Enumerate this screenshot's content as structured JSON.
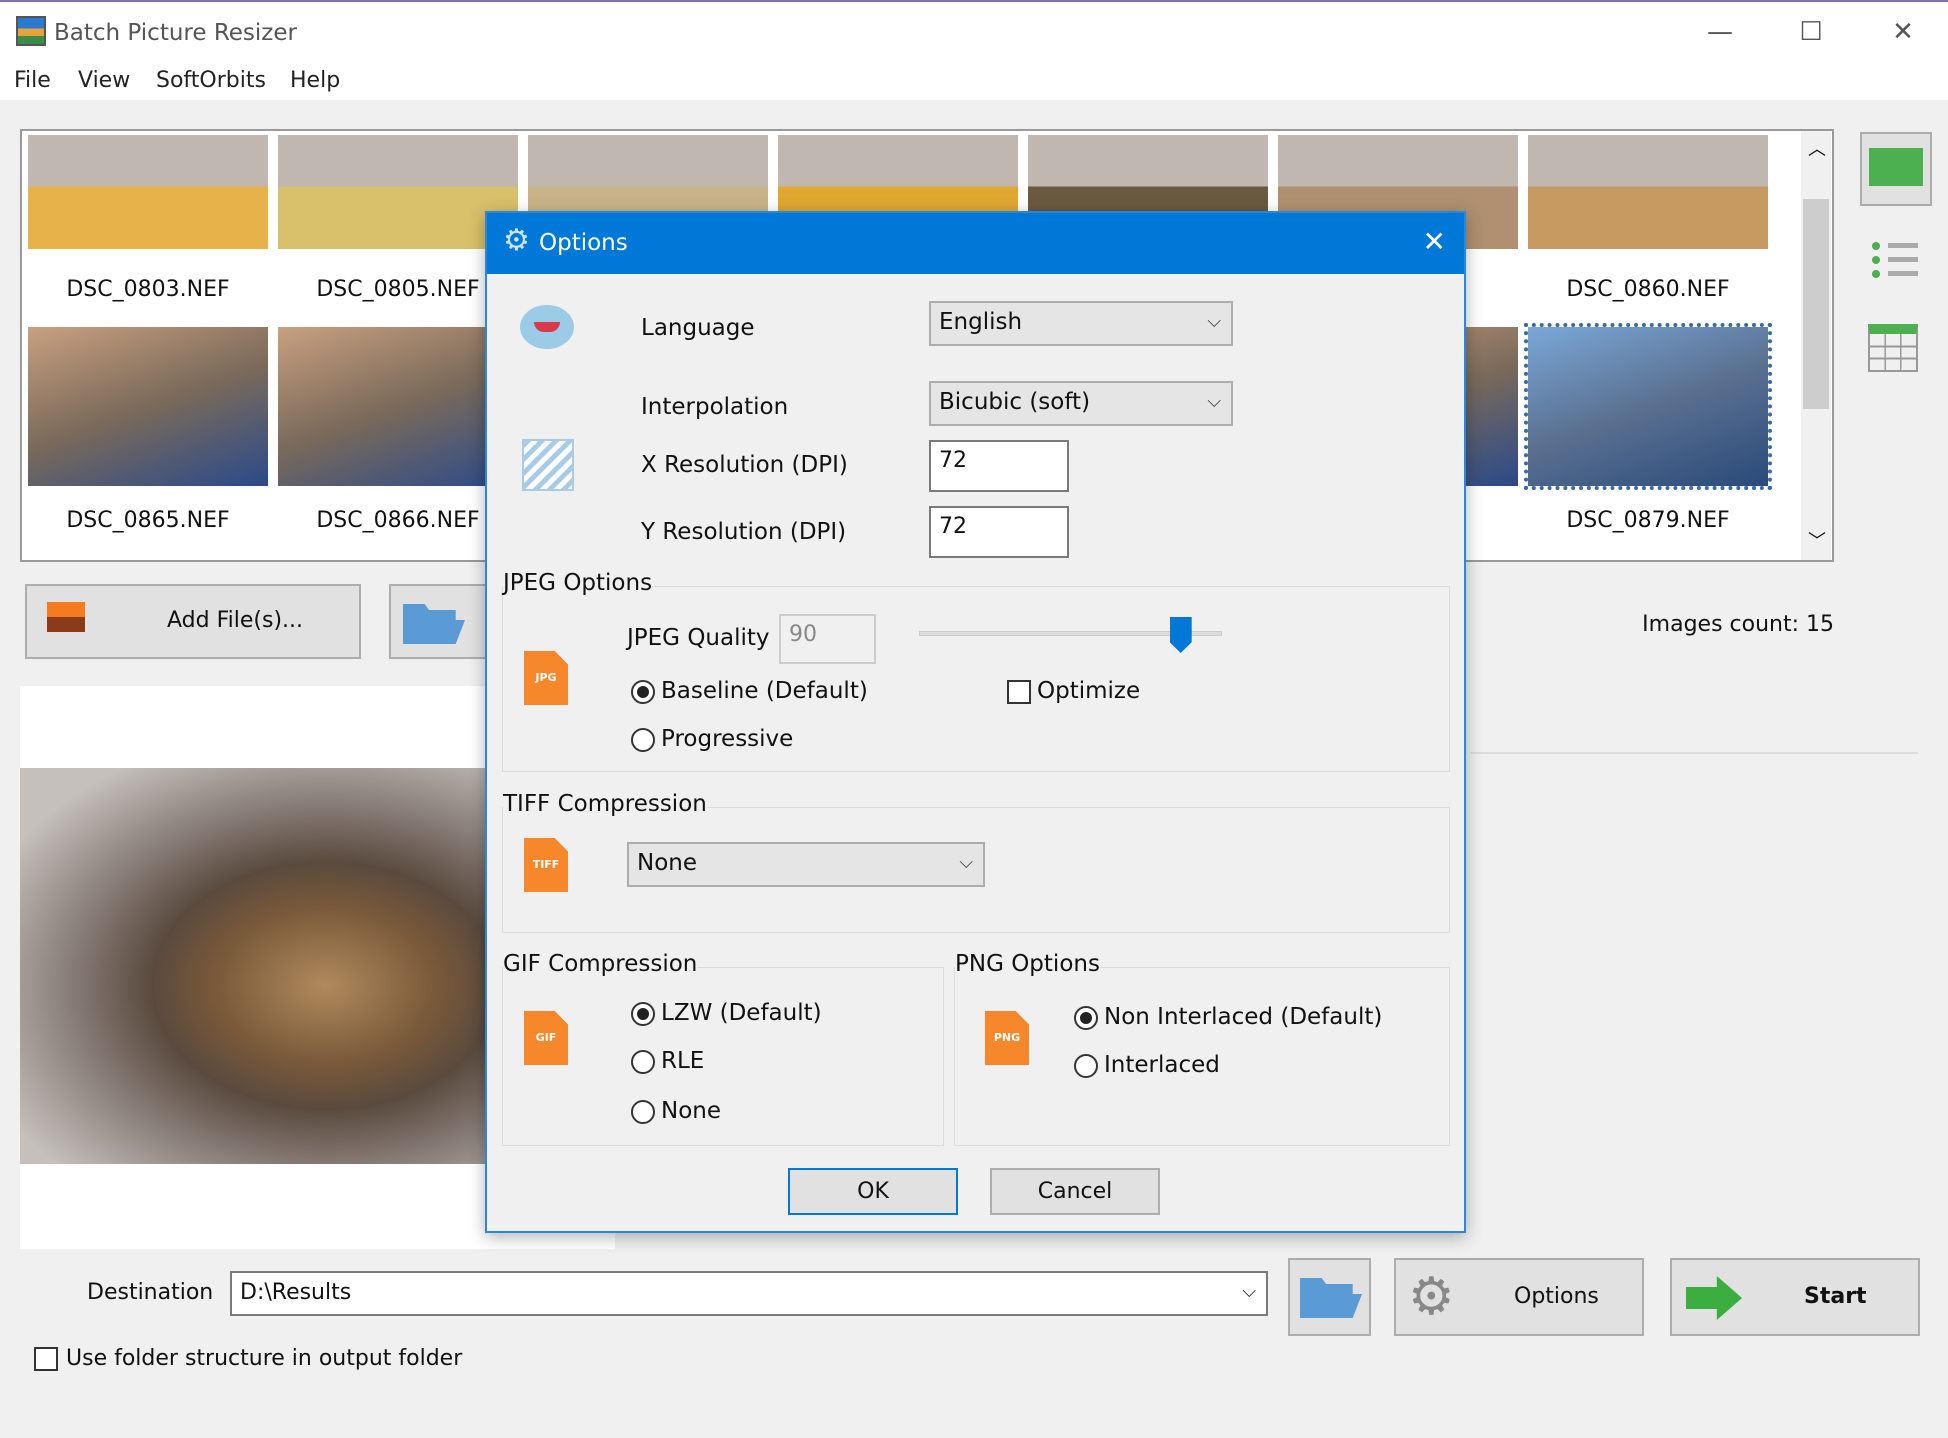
{
  "app": {
    "title": "Batch Picture Resizer",
    "controls": {
      "minimize": "—",
      "maximize": "☐",
      "close": "✕"
    }
  },
  "menu": [
    "File",
    "View",
    "SoftOrbits",
    "Help"
  ],
  "thumbnails": {
    "row1": [
      "DSC_0803.NEF",
      "DSC_0805.NEF",
      "",
      "",
      "",
      "",
      "DSC_0860.NEF"
    ],
    "row2": [
      "DSC_0865.NEF",
      "DSC_0866.NEF",
      "",
      "",
      "",
      "",
      "DSC_0879.NEF"
    ],
    "selected": "DSC_0879.NEF"
  },
  "view_icons": [
    "thumbnail-view-icon",
    "list-view-icon",
    "grid-view-icon"
  ],
  "toolbar": {
    "add_files": "Add File(s)...",
    "images_count": "Images count: 15"
  },
  "bottom": {
    "destination_label": "Destination",
    "destination_value": "D:\\Results",
    "options": "Options",
    "start": "Start",
    "use_folder_structure": "Use folder structure in output folder",
    "use_folder_structure_checked": false
  },
  "dialog": {
    "title": "Options",
    "language_label": "Language",
    "language_value": "English",
    "interpolation_label": "Interpolation",
    "interpolation_value": "Bicubic (soft)",
    "xres_label": "X Resolution (DPI)",
    "xres_value": "72",
    "yres_label": "Y Resolution (DPI)",
    "yres_value": "72",
    "jpeg": {
      "title": "JPEG Options",
      "quality_label": "JPEG Quality",
      "quality_value": "90",
      "quality_slider_percent": 90,
      "baseline": "Baseline (Default)",
      "progressive": "Progressive",
      "selected": "baseline",
      "optimize": "Optimize",
      "optimize_checked": false,
      "icon": "JPG"
    },
    "tiff": {
      "title": "TIFF Compression",
      "value": "None",
      "icon": "TIFF"
    },
    "gif": {
      "title": "GIF Compression",
      "options": [
        "LZW (Default)",
        "RLE",
        "None"
      ],
      "selected": 0,
      "icon": "GIF"
    },
    "png": {
      "title": "PNG Options",
      "options": [
        "Non Interlaced (Default)",
        "Interlaced"
      ],
      "selected": 0,
      "icon": "PNG"
    },
    "ok": "OK",
    "cancel": "Cancel"
  },
  "colors": {
    "accent": "#0078d7",
    "file_icon": "#f7872b",
    "view_icon": "#4caf50"
  }
}
